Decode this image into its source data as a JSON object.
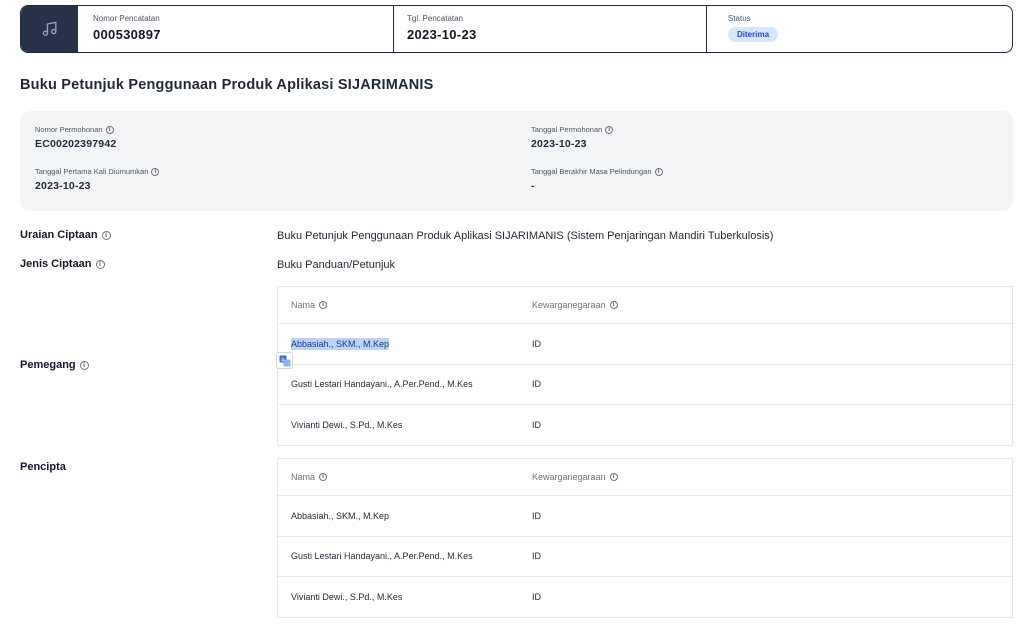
{
  "header": {
    "icon": "music-note-icon",
    "nomor_pencatatan_label": "Nomor Pencatatan",
    "nomor_pencatatan": "000530897",
    "tgl_pencatatan_label": "Tgl. Pencatatan",
    "tgl_pencatatan": "2023-10-23",
    "status_label": "Status",
    "status": "Diterima"
  },
  "title": "Buku Petunjuk Penggunaan Produk Aplikasi SIJARIMANIS",
  "details": {
    "nomor_permohonan_label": "Nomor Permohonan",
    "nomor_permohonan": "EC00202397942",
    "tanggal_permohonan_label": "Tanggal Permohonan",
    "tanggal_permohonan": "2023-10-23",
    "tanggal_diumumkan_label": "Tanggal Pertama Kali Diumumkan",
    "tanggal_diumumkan": "2023-10-23",
    "tanggal_berakhir_label": "Tanggal Berakhir Masa Pelindungan",
    "tanggal_berakhir": "-"
  },
  "uraian": {
    "label": "Uraian Ciptaan",
    "value": "Buku Petunjuk Penggunaan Produk Aplikasi SIJARIMANIS (Sistem Penjaringan Mandiri Tuberkulosis)"
  },
  "jenis": {
    "label": "Jenis Ciptaan",
    "value": "Buku Panduan/Petunjuk"
  },
  "pemegang": {
    "label": "Pemegang",
    "col_name": "Nama",
    "col_nat": "Kewarganegaraan",
    "rows": [
      {
        "name": "Abbasiah., SKM., M.Kep",
        "nat": "ID"
      },
      {
        "name": "Gusti Lestari Handayani., A.Per.Pend., M.Kes",
        "nat": "ID"
      },
      {
        "name": "Vivianti Dewi., S.Pd., M.Kes",
        "nat": "ID"
      }
    ]
  },
  "pencipta": {
    "label": "Pencipta",
    "col_name": "Nama",
    "col_nat": "Kewarganegaraan",
    "rows": [
      {
        "name": "Abbasiah., SKM., M.Kep",
        "nat": "ID"
      },
      {
        "name": "Gusti Lestari Handayani., A.Per.Pend., M.Kes",
        "nat": "ID"
      },
      {
        "name": "Vivianti Dewi., S.Pd., M.Kes",
        "nat": "ID"
      }
    ]
  },
  "colors": {
    "header_dark": "#273248",
    "badge_bg": "#d6e6fb",
    "badge_text": "#1d4ed8",
    "selection": "#bcd3f7"
  }
}
